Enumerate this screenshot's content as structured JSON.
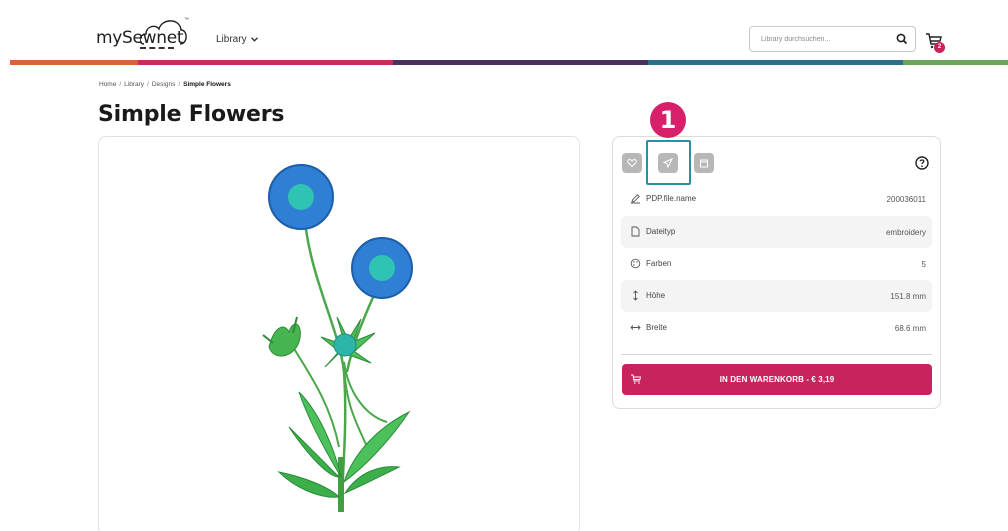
{
  "header": {
    "logo_text": "mySewnet",
    "logo_tm": "™",
    "nav_library": "Library",
    "search_placeholder": "Library durchsuchen...",
    "cart_count": "2"
  },
  "colors": {
    "brand_pink": "#c8235e",
    "marker": "#d81f6a",
    "highlight": "#2a8fa5",
    "bar": [
      "#d4653a",
      "#c82c5a",
      "#4a3160",
      "#2d6e8a",
      "#6aa55a"
    ]
  },
  "breadcrumb": {
    "items": [
      "Home",
      "Library",
      "Designs"
    ],
    "current": "Simple Flowers",
    "separator": "/"
  },
  "page_title": "Simple Flowers",
  "info": {
    "icons": [
      "heart-icon",
      "send-icon",
      "calendar-icon"
    ],
    "help_icon": "help-circle-icon",
    "rows": [
      {
        "icon": "pencil-icon",
        "label": "PDP.file.name",
        "value": "200036011"
      },
      {
        "icon": "file-icon",
        "label": "Dateityp",
        "value": "embroidery"
      },
      {
        "icon": "palette-icon",
        "label": "Farben",
        "value": "5"
      },
      {
        "icon": "height-arrow-icon",
        "label": "Höhe",
        "value": "151.8 mm"
      },
      {
        "icon": "width-arrow-icon",
        "label": "Breite",
        "value": "68.6 mm"
      }
    ],
    "cta_label": "IN DEN WARENKORB - € 3,19"
  },
  "annotation": {
    "marker_label": "1"
  }
}
